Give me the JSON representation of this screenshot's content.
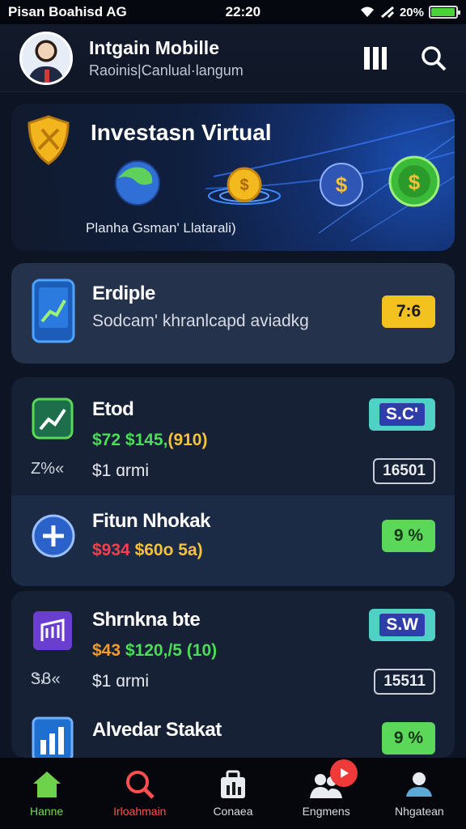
{
  "status_bar": {
    "carrier": "Pisan Boahisd AG",
    "time": "22:20",
    "battery": "20%",
    "battery_level": 0.95
  },
  "header": {
    "title": "Intgain Mobille",
    "subtitle": "Raoinis|Canlual·langum",
    "icons": [
      "pause-icon",
      "search-icon"
    ]
  },
  "hero": {
    "title": "Investasn Virtual",
    "caption": "Planha Gsman' Llatarali)",
    "icons": [
      "shield-icon",
      "globe-icon",
      "coin-icon",
      "dollar-coin-icon",
      "dollar-green-icon"
    ]
  },
  "featured": {
    "name": "Erdiple",
    "description": "Sodcam' khranlcapd aviadkg",
    "badge": "7:6"
  },
  "assets": [
    {
      "name": "Etod",
      "prices": [
        {
          "text": "$72",
          "color": "#4ddb5a"
        },
        {
          "text": "$145,",
          "color": "#4ddb5a"
        },
        {
          "text": "(910)",
          "color": "#f5c23b"
        }
      ],
      "mini_label": "Z%«",
      "sub": "$1 ɑrmi",
      "badge": "S.C'",
      "badge_style": "teal",
      "sub_badge": "16501",
      "icon": "chart-icon"
    },
    {
      "name": "Fitun Nhokak",
      "prices": [
        {
          "text": "$934",
          "color": "#ff3d4b"
        },
        {
          "text": "$60o 5a)",
          "color": "#f5c23b"
        }
      ],
      "badge": "9 %",
      "badge_style": "green",
      "icon": "plus-circle-icon"
    },
    {
      "name": "Shrnkna bte",
      "prices": [
        {
          "text": "$43",
          "color": "#f59b2b"
        },
        {
          "text": "$120,",
          "color": "#4ddb5a"
        },
        {
          "text": "/5 (10)",
          "color": "#4ddb5a"
        }
      ],
      "mini_label": "ᏕᏰ«",
      "sub": "$1 ɑrmi",
      "badge": "S.W",
      "badge_style": "teal",
      "sub_badge": "15511",
      "icon": "building-icon"
    },
    {
      "name": "Alvedar Stakat",
      "prices": [],
      "badge": "9 %",
      "badge_style": "green",
      "icon": "bar-chart-icon"
    }
  ],
  "bottom_nav": [
    {
      "label": "Hanne",
      "icon": "home-icon",
      "state": "active-home"
    },
    {
      "label": "Irloahmain",
      "icon": "search-icon",
      "state": "active-red"
    },
    {
      "label": "Conaea",
      "icon": "portfolio-icon",
      "state": ""
    },
    {
      "label": "Engmens",
      "icon": "people-icon",
      "state": ""
    },
    {
      "label": "Nhgatean",
      "icon": "account-icon",
      "state": ""
    }
  ],
  "colors": {
    "background": "#0d1424",
    "card": "#162136",
    "accent_green": "#5bd85a",
    "accent_yellow": "#f4c21f",
    "accent_red": "#f03a3a"
  }
}
